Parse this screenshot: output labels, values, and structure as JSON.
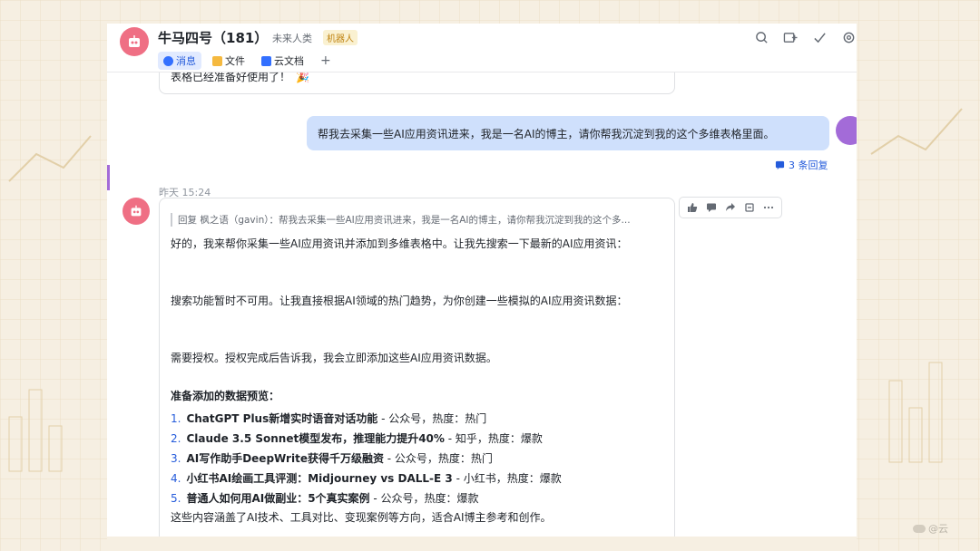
{
  "header": {
    "chat_name": "牛马四号（181）",
    "subtitle": "未来人类",
    "badge": "机器人",
    "tabs": [
      {
        "label": "消息",
        "icon": "message-icon"
      },
      {
        "label": "文件",
        "icon": "folder-icon"
      },
      {
        "label": "云文档",
        "icon": "doc-icon"
      }
    ],
    "add_tab": "+"
  },
  "messages": {
    "previous_tail": "表格已经准备好使用了！",
    "user_message": "帮我去采集一些AI应用资讯进来，我是一名AI的博主，请你帮我沉淀到我的这个多维表格里面。",
    "reply_count": "3 条回复",
    "timestamp": "昨天 15:24",
    "bot_reply": {
      "quote": "回复 枫之语（gavin）：帮我去采集一些AI应用资讯进来，我是一名AI的博主，请你帮我沉淀到我的这个多...",
      "p1": "好的，我来帮你采集一些AI应用资讯并添加到多维表格中。让我先搜索一下最新的AI应用资讯：",
      "p2": "搜索功能暂时不可用。让我直接根据AI领域的热门趋势，为你创建一些模拟的AI应用资讯数据：",
      "p3": "需要授权。授权完成后告诉我，我会立即添加这些AI应用资讯数据。",
      "list_title": "准备添加的数据预览：",
      "items": [
        {
          "num": "1.",
          "title": "ChatGPT Plus新增实时语音对话功能",
          "meta": " - 公众号，热度：热门"
        },
        {
          "num": "2.",
          "title": "Claude 3.5 Sonnet模型发布，推理能力提升40%",
          "meta": " - 知乎，热度：爆款"
        },
        {
          "num": "3.",
          "title": "AI写作助手DeepWrite获得千万级融资",
          "meta": " - 公众号，热度：热门"
        },
        {
          "num": "4.",
          "title": "小红书AI绘画工具评测：Midjourney vs DALL-E 3",
          "meta": " - 小红书，热度：爆款"
        },
        {
          "num": "5.",
          "title": "普通人如何用AI做副业：5个真实案例",
          "meta": " - 公众号，热度：爆款"
        }
      ],
      "summary": "这些内容涵盖了AI技术、工具对比、变现案例等方向，适合AI博主参考和创作。"
    }
  },
  "actions": [
    "thumbs-up-icon",
    "comment-icon",
    "forward-icon",
    "pin-icon",
    "more-icon"
  ],
  "watermark": "@云",
  "colors": {
    "accent": "#245bdb",
    "bubble": "#cfe0fc",
    "bot_avatar": "#ef6f84",
    "background": "#f6efe2"
  }
}
